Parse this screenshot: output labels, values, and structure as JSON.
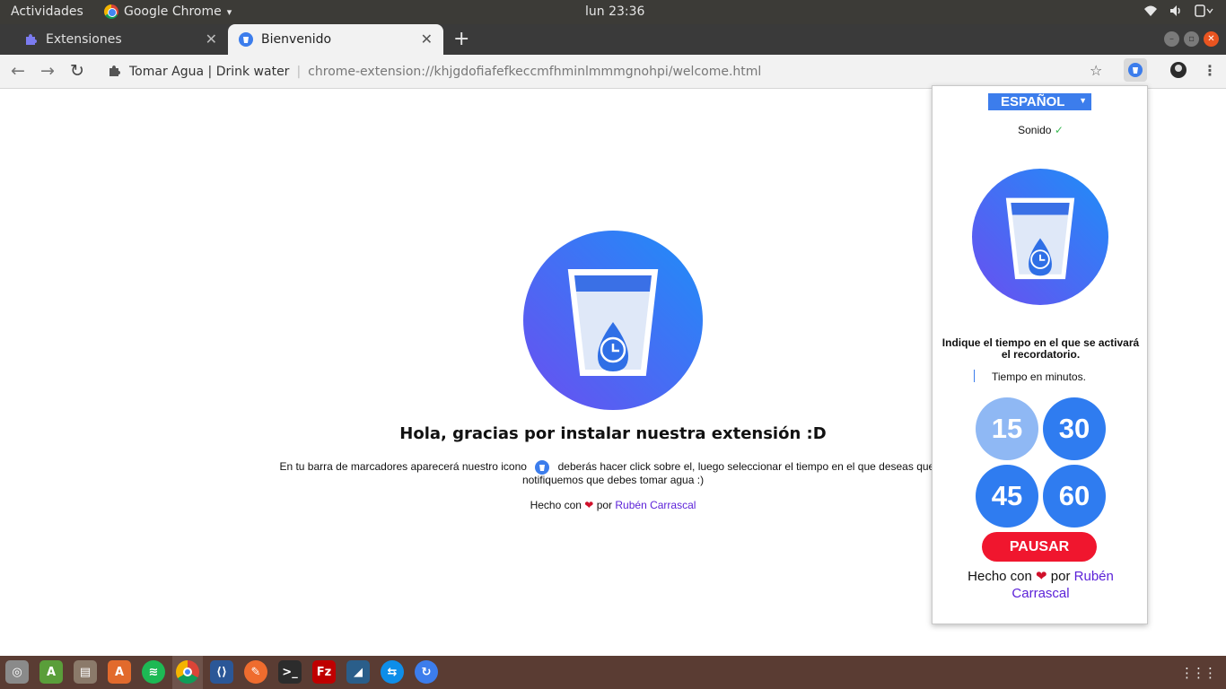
{
  "topbar": {
    "activities": "Actividades",
    "app_name": "Google Chrome",
    "app_caret": "▾",
    "clock": "lun 23:36",
    "tray_icons": [
      "wifi-icon",
      "volume-icon",
      "power-icon"
    ]
  },
  "tabs": [
    {
      "title": "Extensiones",
      "icon": "puzzle-icon",
      "active": false
    },
    {
      "title": "Bienvenido",
      "icon": "water-glass-icon",
      "active": true
    }
  ],
  "toolbar": {
    "site_name": "Tomar Agua | Drink water",
    "url": "chrome-extension://khjgdofiafefkeccmfhminlmmmgnohpi/welcome.html"
  },
  "page": {
    "heading": "Hola, gracias por instalar nuestra extensión :D",
    "text_before_icon": "En tu barra de marcadores aparecerá nuestro icono",
    "text_after_icon": "deberás hacer click sobre el, luego seleccionar el tiempo en el que deseas que te notifiquemos que debes tomar agua :)",
    "made_with": "Hecho con",
    "heart": "❤",
    "by": "por",
    "author": "Rubén Carrascal"
  },
  "popup": {
    "language": "ESPAÑOL",
    "sound_label": "Sonido",
    "sound_check": "✓",
    "instructions": "Indique el tiempo en el que se activará el recordatorio.",
    "minutes_placeholder": "Tiempo en minutos.",
    "time_options": [
      "15",
      "30",
      "45",
      "60"
    ],
    "selected_option": "15",
    "pause_label": "PAUSAR",
    "made_with": "Hecho con",
    "heart": "❤",
    "by": "por",
    "author": "Rubén Carrascal"
  },
  "colors": {
    "accent_blue": "#3c7dec",
    "time_button": "#2f7cf0",
    "time_button_selected": "#8fb8f4",
    "pause_red": "#f0162e",
    "link_purple": "#5a1fd8",
    "gradient_start": "#6a4ff0",
    "gradient_end": "#1e8ef8"
  },
  "dock_icons": [
    "screenshot-icon",
    "android-studio-icon",
    "files-icon",
    "software-center-icon",
    "spotify-icon",
    "chrome-icon",
    "vscode-icon",
    "postman-icon",
    "terminal-icon",
    "filezilla-icon",
    "mysql-workbench-icon",
    "teamviewer-icon",
    "ubuntu-update-icon"
  ]
}
